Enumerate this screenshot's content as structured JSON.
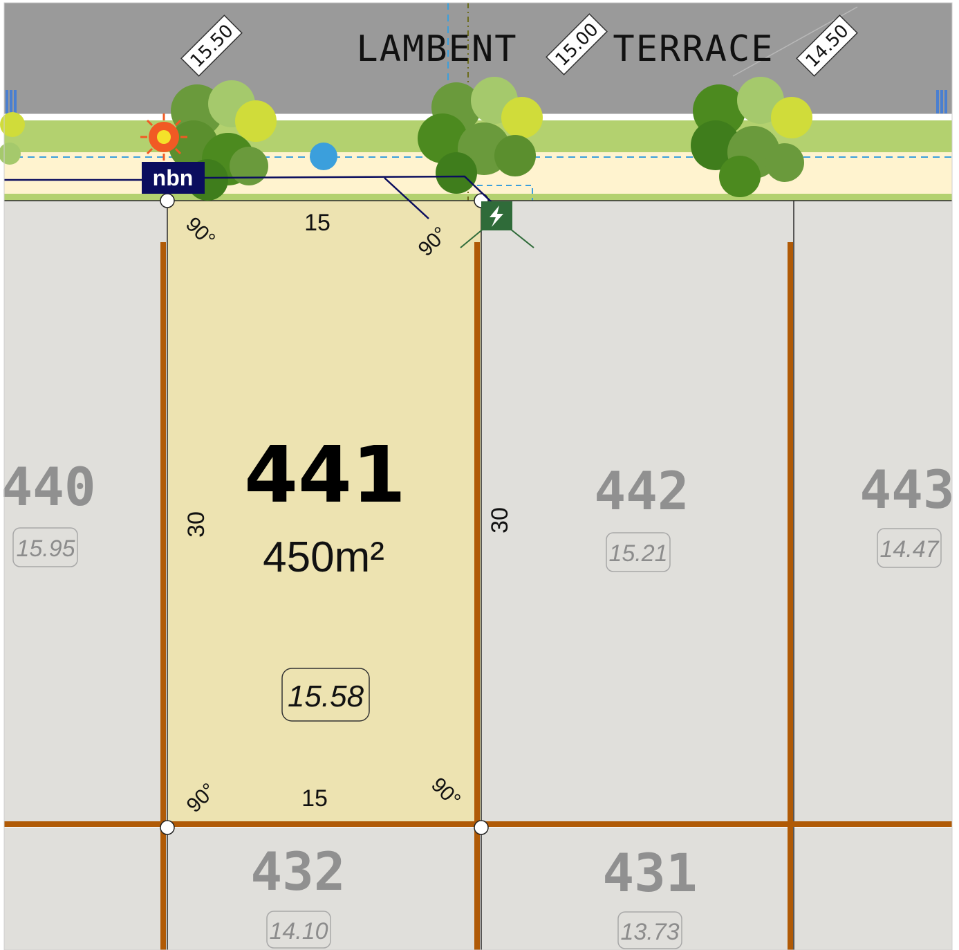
{
  "road": {
    "name_part1": "LAMBENT",
    "name_part2": "TERRACE",
    "levels": [
      "15.50",
      "15.00",
      "14.50"
    ]
  },
  "main_lot": {
    "number": "441",
    "area": "450m²",
    "level": "15.58",
    "frontage": "15",
    "rear": "15",
    "left_depth": "30",
    "right_depth": "30",
    "angle": "90°"
  },
  "neighbour_lots": [
    {
      "number": "440",
      "level": "15.95"
    },
    {
      "number": "442",
      "level": "15.21"
    },
    {
      "number": "443",
      "level": "14.47"
    },
    {
      "number": "432",
      "level": "14.10"
    },
    {
      "number": "431",
      "level": "13.73"
    }
  ],
  "services": {
    "nbn_label": "nbn"
  },
  "colors": {
    "road": "#9a9a9a",
    "verge_green": "#b3d16f",
    "footpath": "#fff3cf",
    "main_lot_fill": "#ede3b1",
    "other_lot_fill": "#e0dfdb",
    "retaining_wall": "#b05a06",
    "nbn_box": "#0b0d5e",
    "power_dome": "#2f6b39",
    "water_dot": "#3b9fdc",
    "light_pole": "#f15a24"
  }
}
